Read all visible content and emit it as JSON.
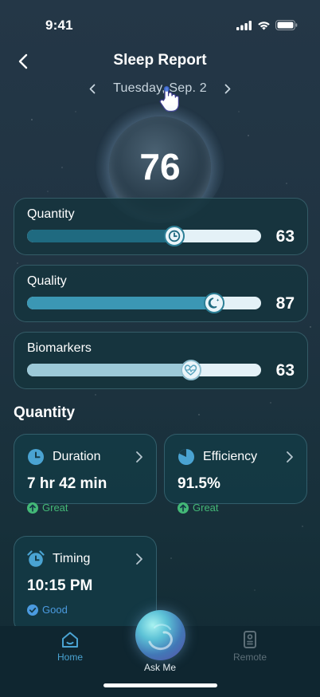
{
  "status_bar": {
    "time": "9:41"
  },
  "header": {
    "title": "Sleep Report",
    "date": "Tuesday, Sep. 2"
  },
  "score": {
    "value": "76"
  },
  "metrics": [
    {
      "label": "Quantity",
      "value": "63",
      "fill": 0.63,
      "knob_icon": "clock-icon",
      "fill_color": "#1f6a80"
    },
    {
      "label": "Quality",
      "value": "87",
      "fill": 0.8,
      "knob_icon": "moon-icon",
      "fill_color": "#3b97b4"
    },
    {
      "label": "Biomarkers",
      "value": "63",
      "fill": 0.7,
      "knob_icon": "heart-pulse-icon",
      "fill_color": "#9cc9d8"
    }
  ],
  "section": {
    "title": "Quantity"
  },
  "details": [
    {
      "title": "Duration",
      "value": "7 hr 42 min",
      "status": "Great",
      "icon": "clock-icon",
      "status_icon": "arrow-up-circle-icon",
      "status_color": "#43b877"
    },
    {
      "title": "Efficiency",
      "value": "91.5%",
      "status": "Great",
      "icon": "pie-chart-icon",
      "status_icon": "arrow-up-circle-icon",
      "status_color": "#43b877"
    },
    {
      "title": "Timing",
      "value": "10:15 PM",
      "status": "Good",
      "icon": "alarm-clock-icon",
      "status_icon": "check-circle-icon",
      "status_color": "#4b9be0"
    }
  ],
  "nav": {
    "home": "Home",
    "ask": "Ask Me",
    "remote": "Remote"
  },
  "colors": {
    "accent": "#4aa3d2",
    "great": "#43b877",
    "good": "#4b9be0"
  }
}
